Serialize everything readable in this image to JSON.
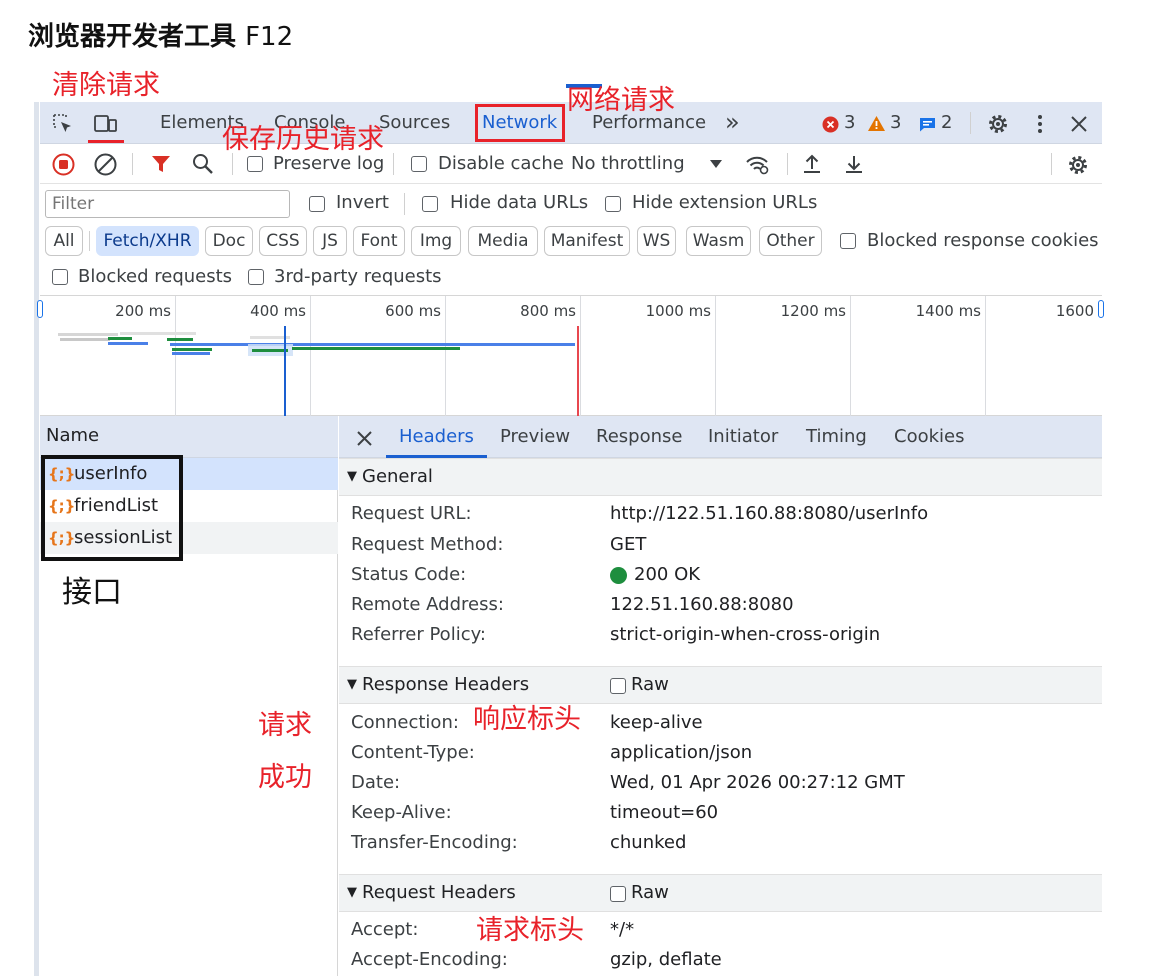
{
  "page_title": {
    "main": "浏览器开发者工具",
    "suffix": "F12"
  },
  "annotations": {
    "clear_requests": "清除请求",
    "network_requests": "网络请求",
    "preserve_history": "保存历史请求",
    "interfaces": "接口",
    "request_line1": "请求",
    "request_line2": "成功",
    "response_headers_note": "响应标头",
    "request_headers_note": "请求标头"
  },
  "tabs": [
    "Elements",
    "Console",
    "Sources",
    "Network",
    "Performance"
  ],
  "more_tabs": "»",
  "counters": {
    "errors": "3",
    "warnings": "3",
    "messages": "2"
  },
  "toolbar": {
    "preserve_log": "Preserve log",
    "disable_cache": "Disable cache",
    "throttling": "No throttling"
  },
  "filter": {
    "placeholder": "Filter",
    "invert": "Invert",
    "hide_data_urls": "Hide data URLs",
    "hide_extension_urls": "Hide extension URLs",
    "types": [
      "All",
      "Fetch/XHR",
      "Doc",
      "CSS",
      "JS",
      "Font",
      "Img",
      "Media",
      "Manifest",
      "WS",
      "Wasm",
      "Other"
    ],
    "active_type": "Fetch/XHR",
    "blocked_response_cookies": "Blocked response cookies",
    "blocked_requests": "Blocked requests",
    "third_party_requests": "3rd-party requests"
  },
  "timeline_ticks": [
    "200 ms",
    "400 ms",
    "600 ms",
    "800 ms",
    "1000 ms",
    "1200 ms",
    "1400 ms",
    "1600"
  ],
  "requests": {
    "column_header": "Name",
    "items": [
      "userInfo",
      "friendList",
      "sessionList"
    ],
    "icon_glyph": "{;}"
  },
  "details": {
    "tabs": [
      "Headers",
      "Preview",
      "Response",
      "Initiator",
      "Timing",
      "Cookies"
    ],
    "selected_tab": "Headers",
    "general": {
      "title": "General",
      "rows": [
        {
          "key": "Request URL:",
          "value": "http://122.51.160.88:8080/userInfo"
        },
        {
          "key": "Request Method:",
          "value": "GET"
        },
        {
          "key": "Status Code:",
          "value": "200 OK"
        },
        {
          "key": "Remote Address:",
          "value": "122.51.160.88:8080"
        },
        {
          "key": "Referrer Policy:",
          "value": "strict-origin-when-cross-origin"
        }
      ]
    },
    "response_headers": {
      "title": "Response Headers",
      "raw": "Raw",
      "rows": [
        {
          "key": "Connection:",
          "value": "keep-alive"
        },
        {
          "key": "Content-Type:",
          "value": "application/json"
        },
        {
          "key": "Date:",
          "value": "Wed, 01 Apr 2026 00:27:12 GMT"
        },
        {
          "key": "Keep-Alive:",
          "value": "timeout=60"
        },
        {
          "key": "Transfer-Encoding:",
          "value": "chunked"
        }
      ]
    },
    "request_headers": {
      "title": "Request Headers",
      "raw": "Raw",
      "rows": [
        {
          "key": "Accept:",
          "value": "*/*"
        },
        {
          "key": "Accept-Encoding:",
          "value": "gzip, deflate"
        }
      ]
    }
  },
  "colors": {
    "accent": "#1a5fd0",
    "annotation": "#e8222a",
    "status_ok": "#1e8e3e",
    "error": "#d93025",
    "warning": "#e37400",
    "info": "#1a73e8"
  }
}
